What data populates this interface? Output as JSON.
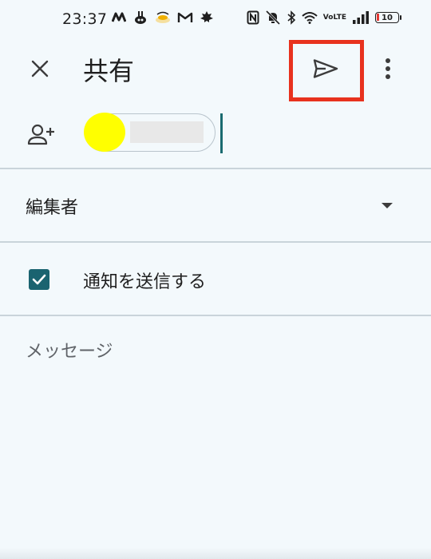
{
  "status_bar": {
    "time": "23:37",
    "battery": "10",
    "network": "VoLTE",
    "icons_left": [
      "m-app-icon",
      "game-app-icon",
      "food-app-icon",
      "gmail-icon",
      "maple-leaf-icon"
    ],
    "icons_right": [
      "nfc-icon",
      "mute-icon",
      "bluetooth-icon",
      "wifi-icon",
      "volte-icon",
      "signal-icon",
      "battery-icon"
    ]
  },
  "app_bar": {
    "title": "共有",
    "close_icon": "close-icon",
    "send_icon": "send-icon",
    "more_icon": "more-vert-icon",
    "highlight_color": "#e8321e"
  },
  "recipients": {
    "add_icon": "person-add-icon",
    "chip_avatar_color": "#ffff00"
  },
  "role": {
    "label": "編集者",
    "caret_icon": "arrow-drop-down-icon"
  },
  "notify": {
    "checked": true,
    "label": "通知を送信する",
    "checkbox_color": "#1a6370"
  },
  "message": {
    "placeholder": "メッセージ",
    "value": ""
  },
  "colors": {
    "background": "#f3f9fc",
    "divider": "#c9d4da",
    "cursor": "#1a6b70"
  }
}
